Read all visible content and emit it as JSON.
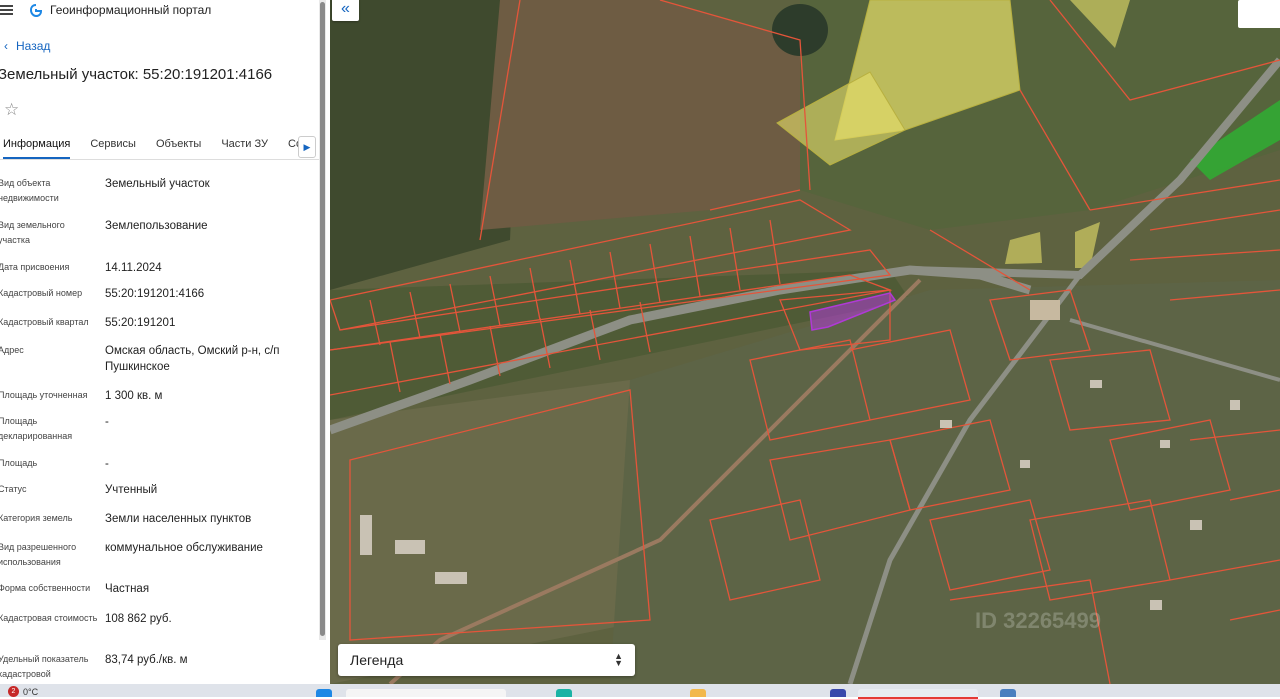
{
  "app": {
    "title": "Геоинформационный портал"
  },
  "nav": {
    "back_label": "Назад"
  },
  "object": {
    "title": "Земельный участок: 55:20:191201:4166"
  },
  "tabs": [
    {
      "label": "Информация"
    },
    {
      "label": "Сервисы"
    },
    {
      "label": "Объекты"
    },
    {
      "label": "Части ЗУ"
    },
    {
      "label": "Состав"
    }
  ],
  "info": [
    {
      "key": "Вид объекта недвижимости",
      "value": "Земельный участок"
    },
    {
      "key": "Вид земельного участка",
      "value": "Землепользование"
    },
    {
      "key": "Дата присвоения",
      "value": "14.11.2024"
    },
    {
      "key": "Кадастровый номер",
      "value": "55:20:191201:4166"
    },
    {
      "key": "Кадастровый квартал",
      "value": "55:20:191201"
    },
    {
      "key": "Адрес",
      "value": "Омская область, Омский р-н, с/п Пушкинское"
    },
    {
      "key": "Площадь уточненная",
      "value": "1 300 кв. м"
    },
    {
      "key": "Площадь декларированная",
      "value": "-"
    },
    {
      "key": "Площадь",
      "value": "-"
    },
    {
      "key": "Статус",
      "value": "Учтенный"
    },
    {
      "key": "Категория земель",
      "value": "Земли населенных пунктов"
    },
    {
      "key": "Вид разрешенного использования",
      "value": "коммунальное обслуживание"
    },
    {
      "key": "Форма собственности",
      "value": "Частная"
    },
    {
      "key": "Кадастровая стоимость",
      "value": "108 862 руб."
    },
    {
      "key": "Удельный показатель кадастровой",
      "value": "83,74 руб./кв. м"
    }
  ],
  "map": {
    "legend_label": "Легенда",
    "watermark": "ID 32265499",
    "colors": {
      "parcel_border": "#e4553a",
      "selected_parcel": "#b03ad6",
      "highlight_yellow": "#e8e06a",
      "highlight_green": "#2fae32"
    }
  },
  "taskbar": {
    "notifications": "2",
    "temperature": "0°C"
  }
}
